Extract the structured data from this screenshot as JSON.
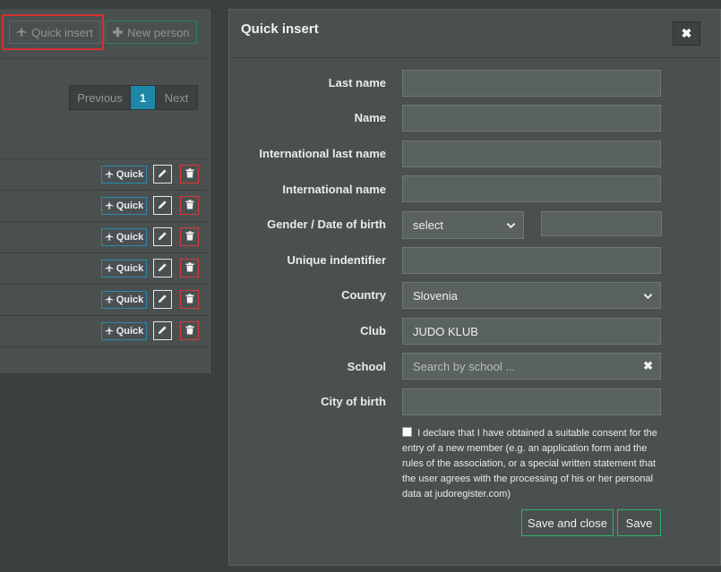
{
  "toolbar": {
    "quick_insert_label": "Quick insert",
    "new_person_label": "New person"
  },
  "pagination": {
    "previous_label": "Previous",
    "current_page": "1",
    "next_label": "Next"
  },
  "rows": [
    {
      "quick_label": "Quick"
    },
    {
      "quick_label": "Quick"
    },
    {
      "quick_label": "Quick"
    },
    {
      "quick_label": "Quick"
    },
    {
      "quick_label": "Quick"
    },
    {
      "quick_label": "Quick"
    }
  ],
  "modal": {
    "title": "Quick insert",
    "close_icon": "times-icon",
    "fields": {
      "last_name": {
        "label": "Last name",
        "value": ""
      },
      "name": {
        "label": "Name",
        "value": ""
      },
      "intl_last_name": {
        "label": "International last name",
        "value": ""
      },
      "intl_name": {
        "label": "International name",
        "value": ""
      },
      "gender_dob": {
        "label": "Gender / Date of birth",
        "gender_value": "select",
        "dob_value": ""
      },
      "unique_id": {
        "label": "Unique indentifier",
        "value": ""
      },
      "country": {
        "label": "Country",
        "value": "Slovenia"
      },
      "club": {
        "label": "Club",
        "value": "JUDO KLUB"
      },
      "school": {
        "label": "School",
        "placeholder": "Search by school ..."
      },
      "city_of_birth": {
        "label": "City of birth",
        "value": ""
      }
    },
    "consent_text": "I declare that I have obtained a suitable consent for the entry of a new member (e.g. an application form and the rules of the association, or a special written statement that the user agrees with the processing of his or her personal data at judoregister.com)",
    "save_and_close_label": "Save and close",
    "save_label": "Save"
  },
  "colors": {
    "highlight": "#d62f2f",
    "accent_blue": "#1e87a8",
    "accent_green": "#2db36a",
    "danger": "#d63b3b"
  }
}
